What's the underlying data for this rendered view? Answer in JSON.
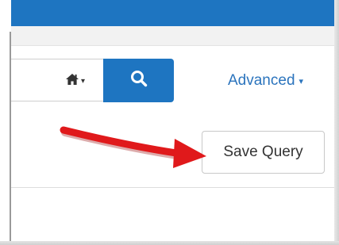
{
  "header": {
    "bar_color": "#1e75c1",
    "subbar_color": "#f2f2f2"
  },
  "search": {
    "scope_icon": "home-icon",
    "scope_caret": "▾",
    "button_icon": "search-icon",
    "button_color": "#1e75c1"
  },
  "advanced": {
    "label": "Advanced",
    "caret": "▾",
    "color": "#2b74bd"
  },
  "save_query": {
    "label": "Save Query"
  },
  "annotation": {
    "arrow_color": "#e0191b",
    "arrow_icon": "red-arrow-annotation"
  }
}
